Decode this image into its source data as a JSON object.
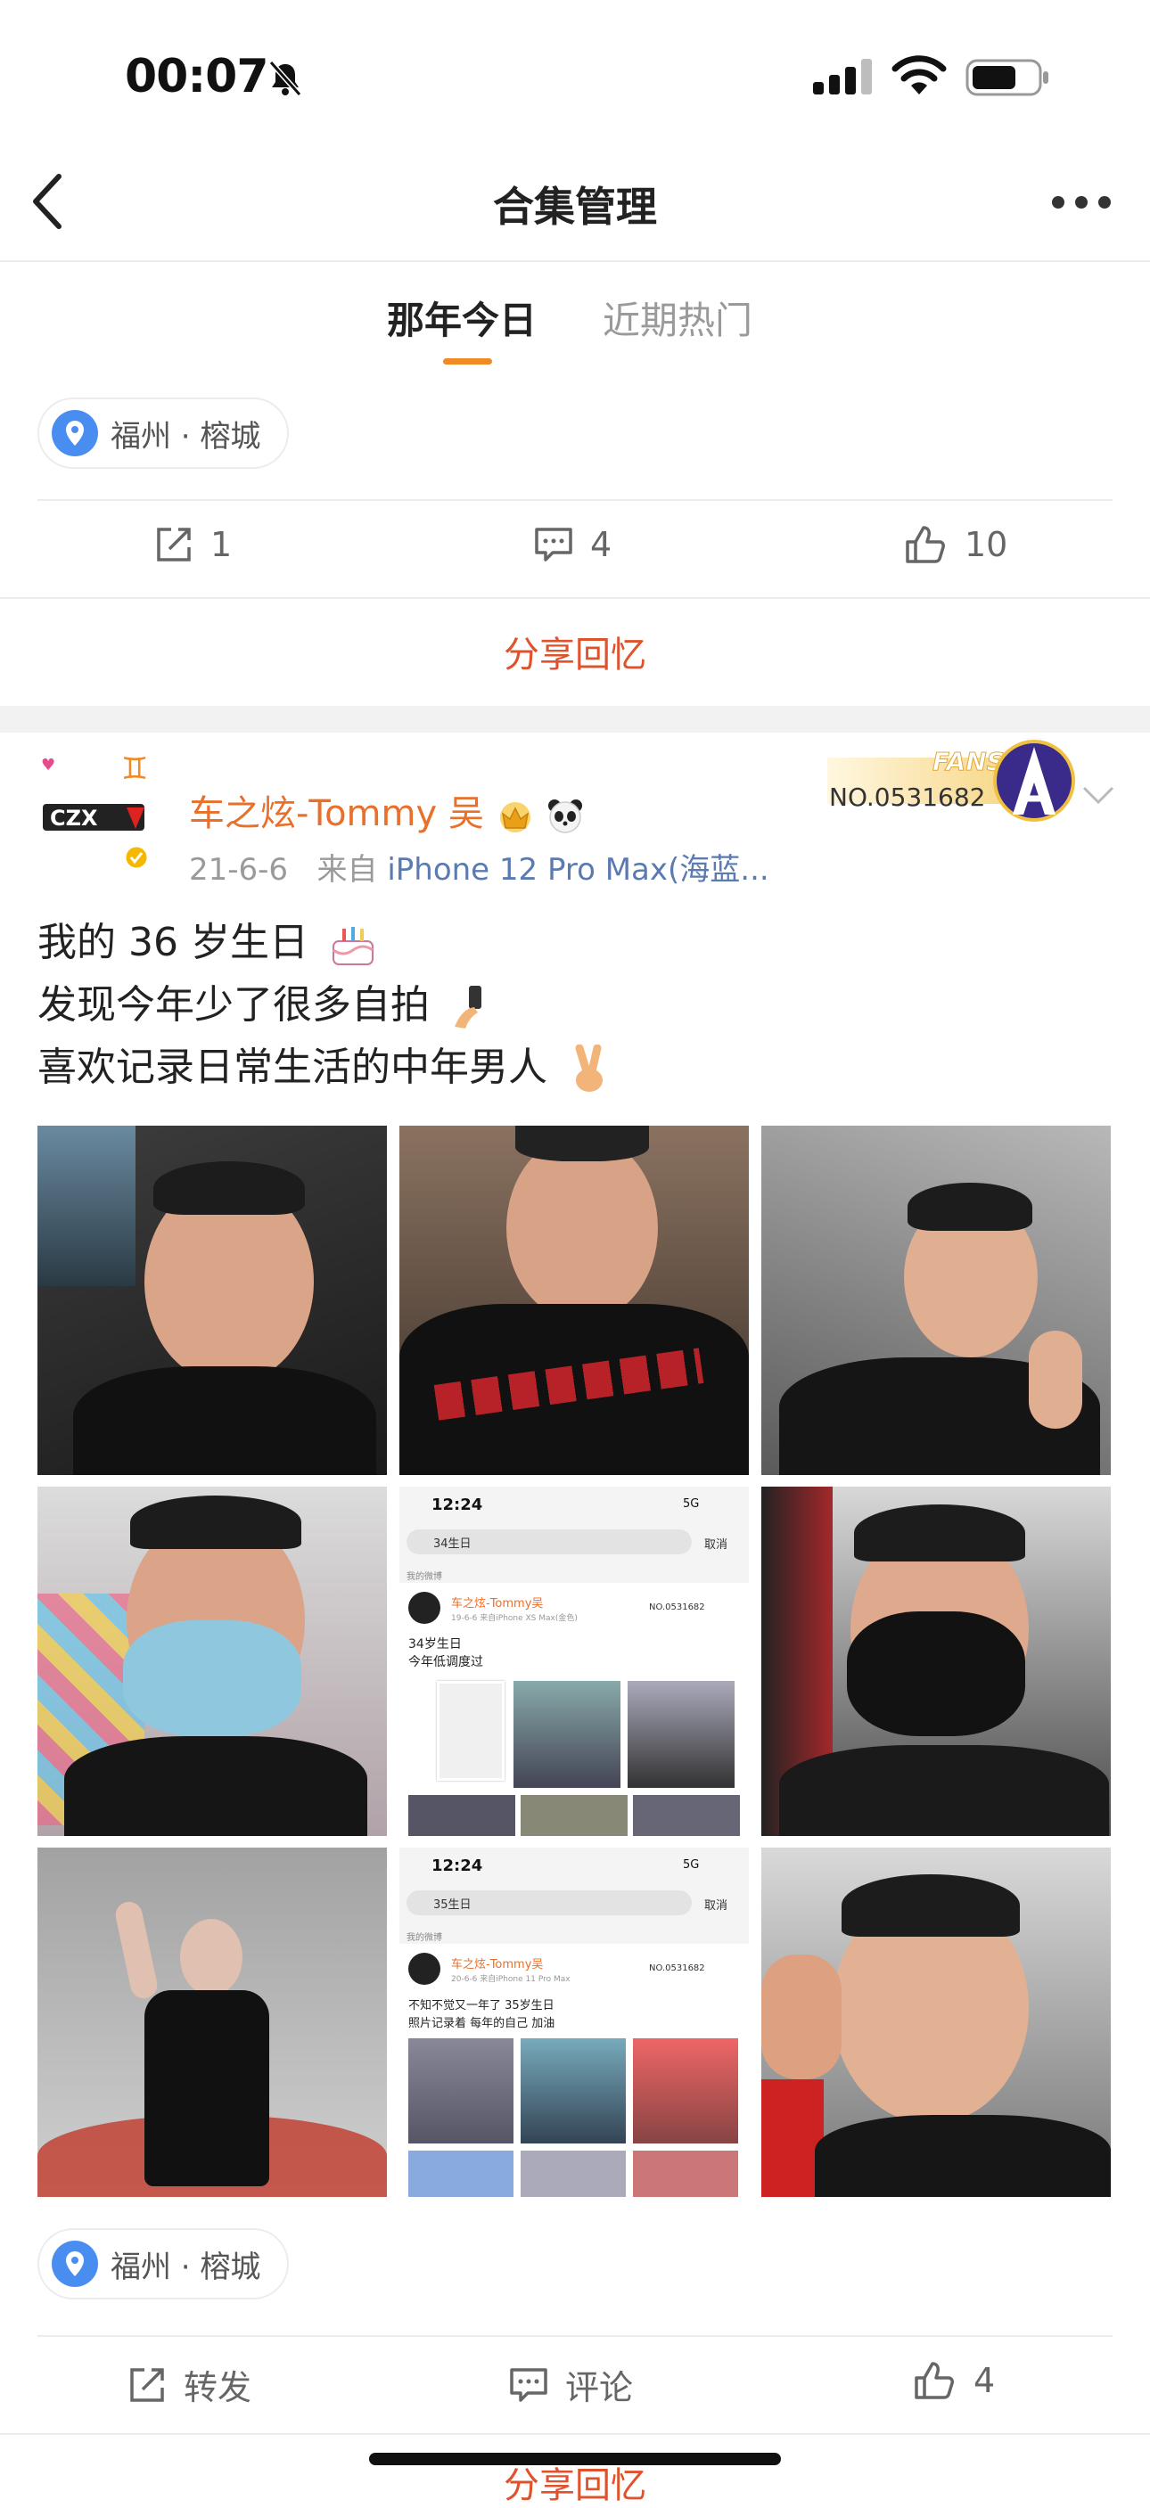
{
  "status_bar": {
    "time": "00:07"
  },
  "nav": {
    "title": "合集管理"
  },
  "tabs": [
    {
      "label": "那年今日",
      "active": true
    },
    {
      "label": "近期热门",
      "active": false
    }
  ],
  "post1": {
    "location": "福州 · 榕城",
    "repost_count": "1",
    "comment_count": "4",
    "like_count": "10",
    "share_memory": "分享回忆"
  },
  "post2": {
    "username": "车之炫-Tommy 吴",
    "date": "21-6-6",
    "source_prefix": "来自",
    "device": "iPhone 12 Pro Max(海蓝...",
    "fans_label": "FANS",
    "fans_number": "NO.0531682",
    "avatar_text": "CZX",
    "text_lines": [
      "我的 36 岁生日",
      "发现今年少了很多自拍",
      "喜欢记录日常生活的中年男人"
    ],
    "location": "福州 · 榕城",
    "repost_label": "转发",
    "comment_label": "评论",
    "like_count": "4",
    "share_memory": "分享回忆"
  },
  "screenshot_a": {
    "time": "12:24",
    "network": "5G",
    "search": "34生日",
    "cancel": "取消",
    "section": "我的微博",
    "user": "车之炫-Tommy吴",
    "meta": "19-6-6 来自iPhone XS Max(金色)",
    "text1": "34岁生日",
    "text2": "今年低调度过",
    "fans_no": "NO.0531682"
  },
  "screenshot_b": {
    "time": "12:24",
    "network": "5G",
    "search": "35生日",
    "cancel": "取消",
    "section": "我的微博",
    "user": "车之炫-Tommy吴",
    "meta": "20-6-6 来自iPhone 11 Pro Max",
    "text1": "不知不觉又一年了 35岁生日",
    "text2": "照片记录着 每年的自己 加油",
    "fans_no": "NO.0531682"
  },
  "colors": {
    "accent": "#f08a24",
    "username": "#e8702a",
    "share": "#e0522c",
    "link": "#5b7bb0"
  }
}
